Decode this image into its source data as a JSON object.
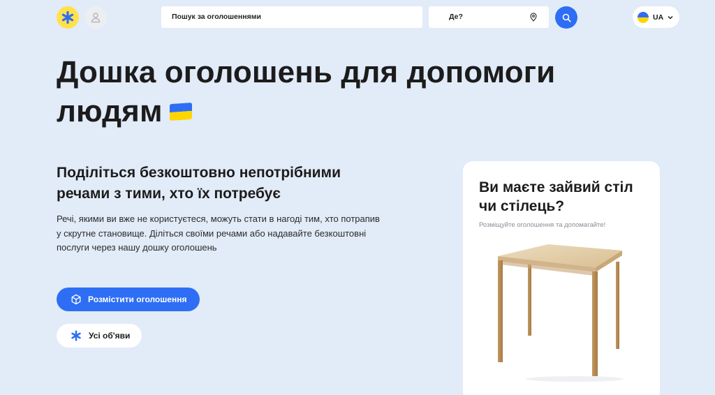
{
  "header": {
    "logo_icon": "asterisk-icon",
    "user_icon": "user-icon",
    "search_placeholder": "Пошук за оголошеннями",
    "location_placeholder": "Де?",
    "location_icon": "map-pin-icon",
    "search_icon": "search-icon",
    "language": "UA",
    "language_icon": "chevron-down-icon"
  },
  "hero": {
    "title": "Дошка оголошень для допомоги людям",
    "subtitle": "Поділіться безкоштовно непотрібними речами з тими, хто їх потребує",
    "description": "Речі, якими ви вже не користуєтеся, можуть стати в нагоді тим, хто потрапив у скрутне становище. Діліться своїми речами або надавайте безкоштовні послуги через нашу дошку оголошень"
  },
  "actions": {
    "post_label": "Розмістити оголошення",
    "post_icon": "box-icon",
    "all_label": "Усі об'яви",
    "all_icon": "asterisk-icon"
  },
  "promo_card": {
    "title": "Ви маєте зайвий стіл чи стілець?",
    "subtitle": "Розміщуйте оголошення та допомагайте!"
  },
  "colors": {
    "background": "#e2ebf8",
    "accent": "#2d6ef5",
    "logo_yellow": "#ffe24a",
    "flag_blue": "#2d6ef5",
    "flag_yellow": "#ffd500"
  }
}
